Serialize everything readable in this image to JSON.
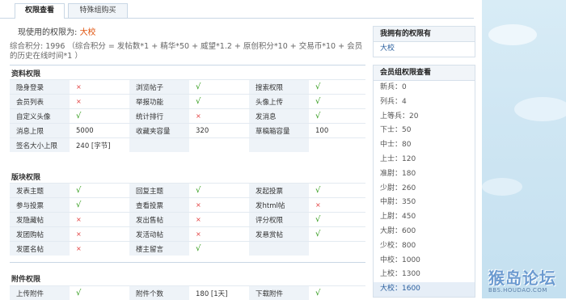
{
  "tabs": [
    {
      "label": "权限查看",
      "active": true
    },
    {
      "label": "特殊组购买",
      "active": false
    }
  ],
  "current_group": {
    "label": "现使用的权限为:",
    "value": "大校"
  },
  "credits_text": "综合积分: 1996 （综合积分 = 发帖数*1 + 精华*50 + 威望*1.2 + 原创积分*10 + 交易币*10 + 会员的历史在线时间*1 ）",
  "sections": {
    "profile": {
      "title": "资料权限",
      "rows": [
        [
          [
            "隐身登录",
            "no"
          ],
          [
            "浏览帖子",
            "ok"
          ],
          [
            "搜索权限",
            "ok"
          ]
        ],
        [
          [
            "会员列表",
            "no"
          ],
          [
            "举报功能",
            "ok"
          ],
          [
            "头像上传",
            "ok"
          ]
        ],
        [
          [
            "自定义头像",
            "ok"
          ],
          [
            "统计排行",
            "no"
          ],
          [
            "发消息",
            "ok"
          ]
        ],
        [
          [
            "消息上限",
            "5000"
          ],
          [
            "收藏夹容量",
            "320"
          ],
          [
            "草稿箱容量",
            "100"
          ]
        ],
        [
          [
            "签名大小上限",
            "240 [字节]"
          ],
          [
            "",
            ""
          ],
          [
            "",
            ""
          ]
        ]
      ]
    },
    "forum": {
      "title": "版块权限",
      "rows": [
        [
          [
            "发表主题",
            "ok"
          ],
          [
            "回复主题",
            "ok"
          ],
          [
            "发起投票",
            "ok"
          ]
        ],
        [
          [
            "参与投票",
            "ok"
          ],
          [
            "查看投票",
            "no"
          ],
          [
            "发html帖",
            "no"
          ]
        ],
        [
          [
            "发隐藏帖",
            "no"
          ],
          [
            "发出售帖",
            "no"
          ],
          [
            "评分权限",
            "ok"
          ]
        ],
        [
          [
            "发团购帖",
            "no"
          ],
          [
            "发活动帖",
            "no"
          ],
          [
            "发悬赏帖",
            "ok"
          ]
        ],
        [
          [
            "发匿名帖",
            "no"
          ],
          [
            "楼主留言",
            "ok"
          ],
          [
            "",
            ""
          ]
        ]
      ]
    },
    "attach": {
      "title": "附件权限",
      "rows": [
        [
          [
            "上传附件",
            "ok"
          ],
          [
            "附件个数",
            "180 [1天]"
          ],
          [
            "下载附件",
            "ok"
          ]
        ]
      ]
    }
  },
  "marks": {
    "ok": "√",
    "no": "×"
  },
  "sidebar": {
    "owned_title": "我拥有的权限有",
    "owned_value": "大校",
    "groups_title": "会员组权限查看",
    "groups": [
      "新兵：0",
      "列兵：4",
      "上等兵：20",
      "下士：50",
      "中士：80",
      "上士：120",
      "准尉：180",
      "少尉：260",
      "中尉：350",
      "上尉：450",
      "大尉：600",
      "少校：800",
      "中校：1000",
      "上校：1300",
      "大校：1600"
    ],
    "highlighted": "大校：1600"
  },
  "watermark": {
    "main": "猴岛论坛",
    "sub": "BBS.HOUDAO.COM"
  },
  "colors": {
    "accent": "#e0540e",
    "ok": "#2e9a16",
    "no": "#e23b3b",
    "link": "#2a5f9e"
  }
}
